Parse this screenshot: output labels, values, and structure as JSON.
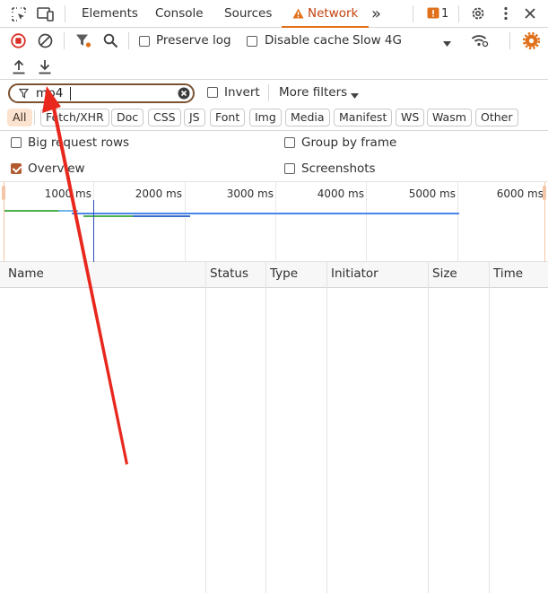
{
  "tabs": {
    "elements": "Elements",
    "console": "Console",
    "sources": "Sources",
    "network": "Network",
    "more": "»",
    "issues_count": "1"
  },
  "toolbar": {
    "preserve_log": "Preserve log",
    "disable_cache": "Disable cache",
    "throttling": "Slow 4G"
  },
  "filter": {
    "value": "mp4",
    "invert": "Invert",
    "more_filters": "More filters"
  },
  "types": [
    "All",
    "Fetch/XHR",
    "Doc",
    "CSS",
    "JS",
    "Font",
    "Img",
    "Media",
    "Manifest",
    "WS",
    "Wasm",
    "Other"
  ],
  "options": {
    "big_request_rows": "Big request rows",
    "group_by_frame": "Group by frame",
    "overview": "Overview",
    "screenshots": "Screenshots",
    "big_request_rows_checked": false,
    "group_by_frame_checked": false,
    "overview_checked": true,
    "screenshots_checked": false
  },
  "timeline": {
    "ticks": [
      "1000 ms",
      "2000 ms",
      "3000 ms",
      "4000 ms",
      "5000 ms",
      "6000 ms"
    ]
  },
  "table": {
    "columns": [
      "Name",
      "Status",
      "Type",
      "Initiator",
      "Size",
      "Time"
    ]
  },
  "colors": {
    "accent": "#e0701a",
    "record_red": "#d93025",
    "checkbox_checked": "#b35a2e",
    "annotation_arrow": "#e8271d"
  }
}
